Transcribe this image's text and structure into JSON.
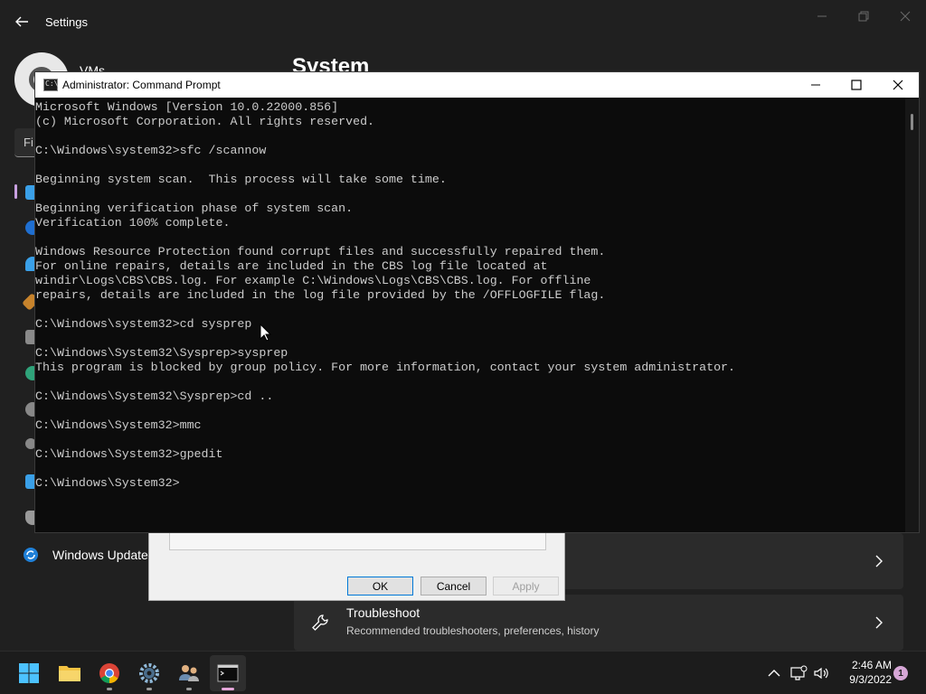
{
  "settings": {
    "window_title": "Settings",
    "user_name": "VMs",
    "page_heading": "System",
    "search_placeholder": "Fi",
    "nav_update_label": "Windows Update",
    "troubleshoot": {
      "title": "Troubleshoot",
      "subtitle": "Recommended troubleshooters, preferences, history"
    }
  },
  "dialog": {
    "ok_label": "OK",
    "cancel_label": "Cancel",
    "apply_label": "Apply"
  },
  "cmd": {
    "title": "Administrator: Command Prompt",
    "icon_text": "C:\\",
    "lines": [
      "Microsoft Windows [Version 10.0.22000.856]",
      "(c) Microsoft Corporation. All rights reserved.",
      "",
      "C:\\Windows\\system32>sfc /scannow",
      "",
      "Beginning system scan.  This process will take some time.",
      "",
      "Beginning verification phase of system scan.",
      "Verification 100% complete.",
      "",
      "Windows Resource Protection found corrupt files and successfully repaired them.",
      "For online repairs, details are included in the CBS log file located at",
      "windir\\Logs\\CBS\\CBS.log. For example C:\\Windows\\Logs\\CBS\\CBS.log. For offline",
      "repairs, details are included in the log file provided by the /OFFLOGFILE flag.",
      "",
      "C:\\Windows\\system32>cd sysprep",
      "",
      "C:\\Windows\\System32\\Sysprep>sysprep",
      "This program is blocked by group policy. For more information, contact your system administrator.",
      "",
      "C:\\Windows\\System32\\Sysprep>cd ..",
      "",
      "C:\\Windows\\System32>mmc",
      "",
      "C:\\Windows\\System32>gpedit",
      "",
      "C:\\Windows\\System32>"
    ]
  },
  "taskbar": {
    "apps": [
      {
        "name": "start-button",
        "icon": "windows-logo-icon"
      },
      {
        "name": "file-explorer",
        "icon": "folder-icon"
      },
      {
        "name": "chrome",
        "icon": "chrome-icon"
      },
      {
        "name": "settings",
        "icon": "gear-icon"
      },
      {
        "name": "users",
        "icon": "users-icon"
      },
      {
        "name": "command-prompt",
        "icon": "terminal-icon"
      }
    ],
    "time": "2:46 AM",
    "date": "9/3/2022",
    "notification_count": "1"
  },
  "colors": {
    "accent": "#e3a6d8",
    "console_bg": "#0c0c0c",
    "console_text": "#cccccc",
    "settings_bg": "#202020",
    "taskbar_bg": "#1c1c1c"
  }
}
